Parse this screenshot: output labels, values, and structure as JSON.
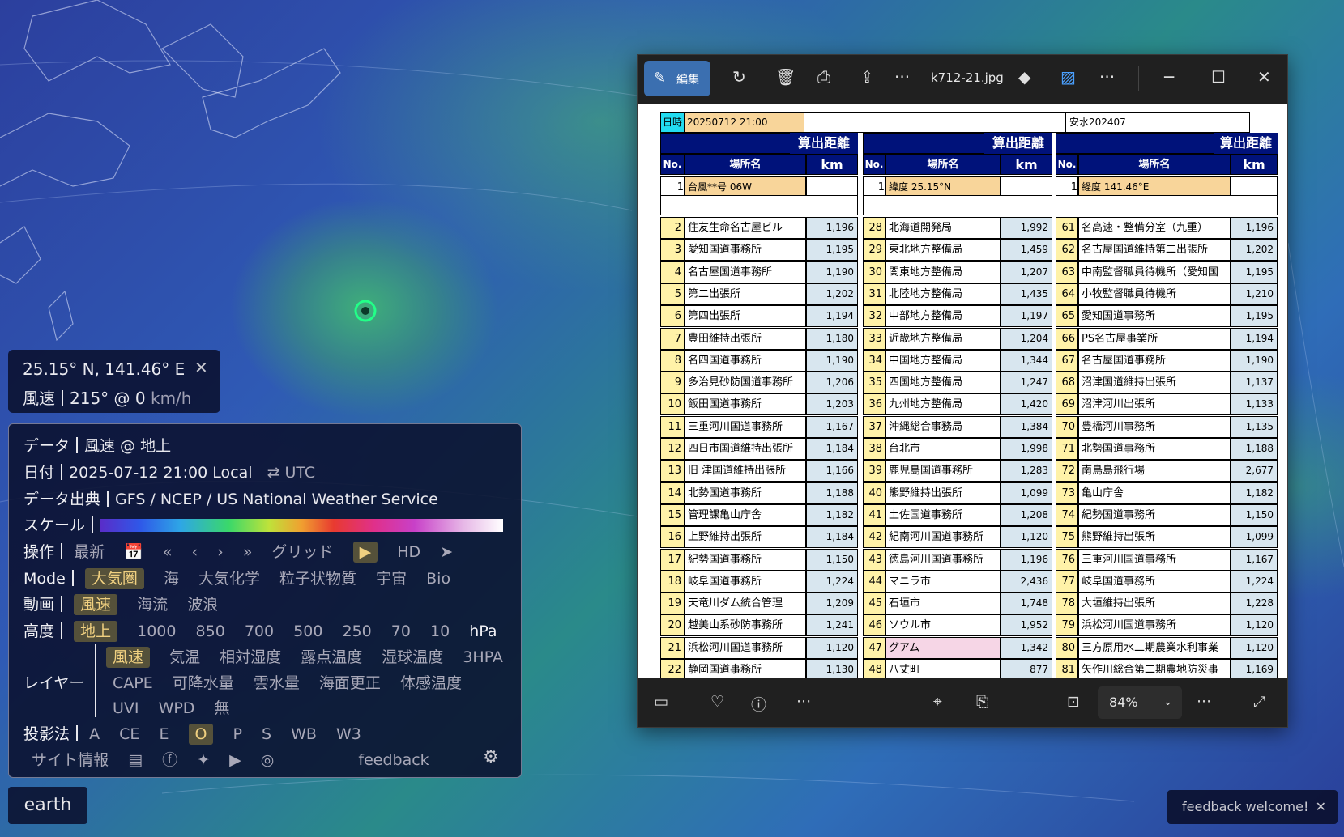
{
  "map": {
    "coord_text": "25.15° N, 141.46° E",
    "wind_label": "風速",
    "wind_value": "215° @ 0",
    "wind_unit": "km/h",
    "close": "✕"
  },
  "menu": {
    "data_label": "データ",
    "data_value": "風速 @ 地上",
    "date_label": "日付",
    "date_value": "2025-07-12 21:00 Local",
    "utc_toggle": "⇄ UTC",
    "source_label": "データ出典",
    "source_value": "GFS / NCEP / US National Weather Service",
    "scale_label": "スケール",
    "control_label": "操作",
    "controls": [
      "最新",
      "📅",
      "«",
      "‹",
      "›",
      "»",
      "グリッド",
      "▶",
      "HD",
      "➤"
    ],
    "mode_label": "Mode",
    "modes": [
      "大気圏",
      "海",
      "大気化学",
      "粒子状物質",
      "宇宙",
      "Bio"
    ],
    "anim_label": "動画",
    "anims": [
      "風速",
      "海流",
      "波浪"
    ],
    "height_label": "高度",
    "heights": [
      "地上",
      "1000",
      "850",
      "700",
      "500",
      "250",
      "70",
      "10",
      "hPa"
    ],
    "layer_label": "レイヤー",
    "layers_row1": [
      "風速",
      "気温",
      "相対湿度",
      "露点温度",
      "湿球温度",
      "3HPA"
    ],
    "layers_row2": [
      "CAPE",
      "可降水量",
      "雲水量",
      "海面更正",
      "体感温度"
    ],
    "layers_row3": [
      "UVI",
      "WPD",
      "無"
    ],
    "projection_label": "投影法",
    "projections": [
      "A",
      "CE",
      "E",
      "O",
      "P",
      "S",
      "WB",
      "W3"
    ],
    "site_info": "サイト情報",
    "feedback": "feedback"
  },
  "earth_badge": "earth",
  "toast": {
    "text": "feedback welcome!",
    "close": "✕"
  },
  "viewer": {
    "edit_label": "編集",
    "filename": "k712-21.jpg",
    "zoom": "84%",
    "sheet": {
      "datetime_label": "日時",
      "datetime_value": "20250712 21:00",
      "ref_label": "安水202407",
      "header_top": "算出距離",
      "header_no": "No.",
      "header_place": "場所名",
      "header_km": "km",
      "row1": [
        {
          "no": "1",
          "name": "台風**号 06W"
        },
        {
          "no": "1",
          "name": "緯度 25.15°N"
        },
        {
          "no": "1",
          "name": "経度 141.46°E"
        }
      ],
      "col1": [
        [
          "2",
          "住友生命名古屋ビル",
          "1,196"
        ],
        [
          "3",
          "愛知国道事務所",
          "1,195"
        ],
        [
          "4",
          "名古屋国道事務所",
          "1,190"
        ],
        [
          "5",
          "第二出張所",
          "1,202"
        ],
        [
          "6",
          "第四出張所",
          "1,194"
        ],
        [
          "7",
          "豊田維持出張所",
          "1,180"
        ],
        [
          "8",
          "名四国道事務所",
          "1,190"
        ],
        [
          "9",
          "多治見砂防国道事務所",
          "1,206"
        ],
        [
          "10",
          "飯田国道事務所",
          "1,203"
        ],
        [
          "11",
          "三重河川国道事務所",
          "1,167"
        ],
        [
          "12",
          "四日市国道維持出張所",
          "1,184"
        ],
        [
          "13",
          "旧 津国道維持出張所",
          "1,166"
        ],
        [
          "14",
          "北勢国道事務所",
          "1,188"
        ],
        [
          "15",
          "管理課亀山庁舎",
          "1,182"
        ],
        [
          "16",
          "上野維持出張所",
          "1,184"
        ],
        [
          "17",
          "紀勢国道事務所",
          "1,150"
        ],
        [
          "18",
          "岐阜国道事務所",
          "1,224"
        ],
        [
          "19",
          "天竜川ダム統合管理",
          "1,209"
        ],
        [
          "20",
          "越美山系砂防事務所",
          "1,241"
        ],
        [
          "21",
          "浜松河川国道事務所",
          "1,120"
        ],
        [
          "22",
          "静岡国道事務所",
          "1,130"
        ]
      ],
      "col2": [
        [
          "28",
          "北海道開発局",
          "1,992"
        ],
        [
          "29",
          "東北地方整備局",
          "1,459"
        ],
        [
          "30",
          "関東地方整備局",
          "1,207"
        ],
        [
          "31",
          "北陸地方整備局",
          "1,435"
        ],
        [
          "32",
          "中部地方整備局",
          "1,197"
        ],
        [
          "33",
          "近畿地方整備局",
          "1,204"
        ],
        [
          "34",
          "中国地方整備局",
          "1,344"
        ],
        [
          "35",
          "四国地方整備局",
          "1,247"
        ],
        [
          "36",
          "九州地方整備局",
          "1,420"
        ],
        [
          "37",
          "沖縄総合事務局",
          "1,384"
        ],
        [
          "38",
          "台北市",
          "1,998"
        ],
        [
          "39",
          "鹿児島国道事務所",
          "1,283"
        ],
        [
          "40",
          "熊野維持出張所",
          "1,099"
        ],
        [
          "41",
          "土佐国道事務所",
          "1,208"
        ],
        [
          "42",
          "紀南河川国道事務所",
          "1,120"
        ],
        [
          "43",
          "徳島河川国道事務所",
          "1,196"
        ],
        [
          "44",
          "マニラ市",
          "2,436"
        ],
        [
          "45",
          "石垣市",
          "1,748"
        ],
        [
          "46",
          "ソウル市",
          "1,952"
        ],
        [
          "47",
          "グアム",
          "1,342"
        ],
        [
          "48",
          "八丈町",
          "877"
        ]
      ],
      "col3": [
        [
          "61",
          "名高速・整備分室（九重）",
          "1,196"
        ],
        [
          "62",
          "名古屋国道維持第二出張所",
          "1,202"
        ],
        [
          "63",
          "中南監督職員待機所（愛知国",
          "1,195"
        ],
        [
          "64",
          "小牧監督職員待機所",
          "1,210"
        ],
        [
          "65",
          "愛知国道事務所",
          "1,195"
        ],
        [
          "66",
          "PS名古屋事業所",
          "1,194"
        ],
        [
          "67",
          "名古屋国道事務所",
          "1,190"
        ],
        [
          "68",
          "沼津国道維持出張所",
          "1,137"
        ],
        [
          "69",
          "沼津河川出張所",
          "1,133"
        ],
        [
          "70",
          "豊橋河川事務所",
          "1,135"
        ],
        [
          "71",
          "北勢国道事務所",
          "1,188"
        ],
        [
          "72",
          "南鳥島飛行場",
          "2,677"
        ],
        [
          "73",
          "亀山庁舎",
          "1,182"
        ],
        [
          "74",
          "紀勢国道事務所",
          "1,150"
        ],
        [
          "75",
          "熊野維持出張所",
          "1,099"
        ],
        [
          "76",
          "三重河川国道事務所",
          "1,167"
        ],
        [
          "77",
          "岐阜国道事務所",
          "1,224"
        ],
        [
          "78",
          "大垣維持出張所",
          "1,228"
        ],
        [
          "79",
          "浜松河川国道事務所",
          "1,120"
        ],
        [
          "80",
          "三方原用水二期農業水利事業",
          "1,120"
        ],
        [
          "81",
          "矢作川総合第二期農地防災事",
          "1,169"
        ]
      ]
    }
  },
  "colors": {
    "accent": "#3b6fb0",
    "sheet_header": "#00127a",
    "typhoon_eye": "#22ff88"
  }
}
